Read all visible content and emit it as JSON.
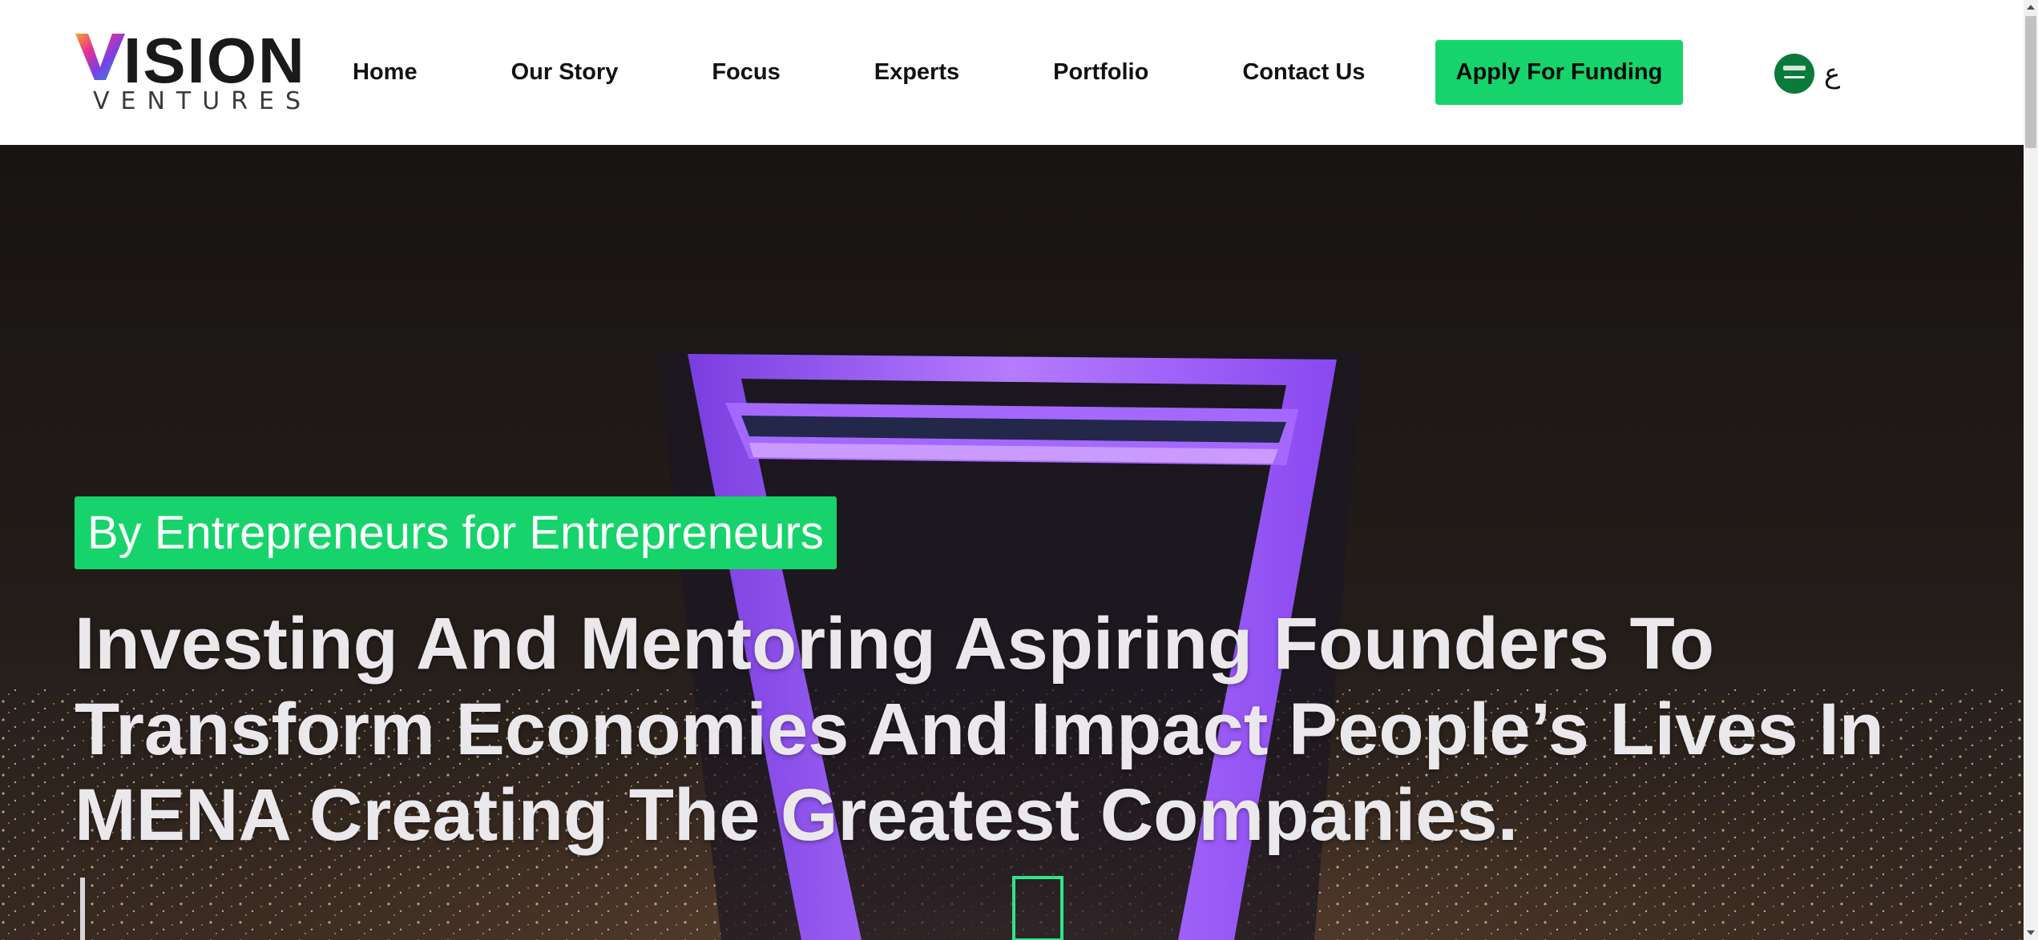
{
  "logo": {
    "word": "ISION",
    "sub": "VENTURES",
    "alt_text": "VISION VENTURES"
  },
  "nav": {
    "items": [
      {
        "label": "Home"
      },
      {
        "label": "Our Story"
      },
      {
        "label": "Focus"
      },
      {
        "label": "Experts"
      },
      {
        "label": "Portfolio"
      },
      {
        "label": "Contact Us"
      }
    ],
    "cta_label": "Apply For Funding",
    "language_label": "ع",
    "language_flag_icon": "saudi-flag-icon"
  },
  "hero": {
    "tagline": "By Entrepreneurs for Entrepreneurs",
    "headline": "Investing And Mentoring Aspiring Founders To Transform Economies And Impact People’s Lives In MENA Creating The Greatest Companies.",
    "background_image": "kingdom-centre-night-skyline"
  },
  "colors": {
    "accent": "#16d46b",
    "nav_text": "#111111",
    "hero_text": "#ebe8ec",
    "tower_glow": "#9b4dff"
  }
}
